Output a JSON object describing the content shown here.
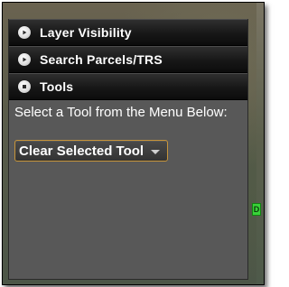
{
  "accordion": {
    "sections": [
      {
        "label": "Layer Visibility",
        "icon": "play-arrow-icon",
        "expanded": false
      },
      {
        "label": "Search Parcels/TRS",
        "icon": "play-arrow-icon",
        "expanded": false
      },
      {
        "label": "Tools",
        "icon": "stop-square-icon",
        "expanded": true
      }
    ]
  },
  "tools": {
    "prompt": "Select a Tool from the Menu Below:",
    "dropdown": {
      "selected": "Clear Selected Tool",
      "icon": "caret-down-icon"
    }
  },
  "map": {
    "marker_text": "D"
  },
  "colors": {
    "panel_bg": "#585858",
    "header_bg": "#171717",
    "dropdown_border": "#c6943a",
    "marker": "#39d339"
  }
}
